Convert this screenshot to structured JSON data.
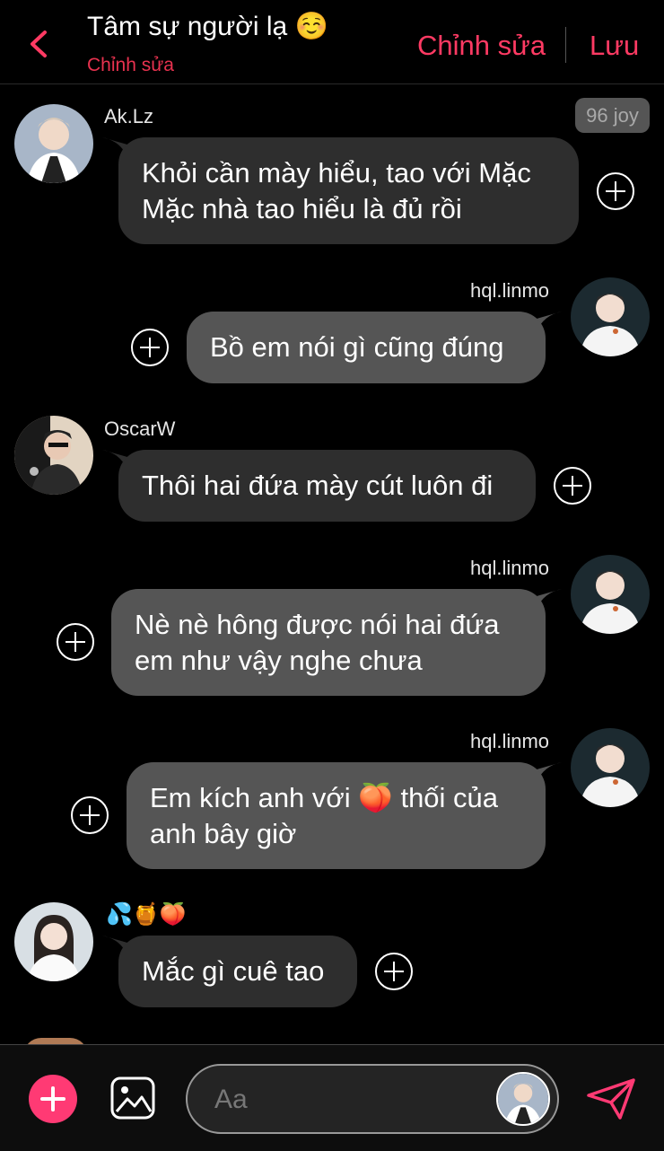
{
  "header": {
    "title": "Tâm sự người lạ ☺️",
    "subtitle": "Chỉnh sửa",
    "edit_label": "Chỉnh sửa",
    "save_label": "Lưu",
    "accent": "#ff3a63"
  },
  "badge": "96 joy",
  "messages": [
    {
      "sender": "Ak.Lz",
      "side": "left",
      "text_lines": [
        "Khỏi cần mày hiểu, tao với Mặc",
        "Mặc nhà tao hiểu là đủ rồi"
      ]
    },
    {
      "sender": "hql.linmo",
      "side": "right",
      "text_lines": [
        "Bồ em nói gì cũng đúng"
      ]
    },
    {
      "sender": "OscarW",
      "side": "left",
      "text_lines": [
        "Thôi hai đứa mày cút luôn đi"
      ]
    },
    {
      "sender": "hql.linmo",
      "side": "right",
      "text_lines": [
        "Nè nè hông được nói hai đứa",
        "em như vậy nghe chưa"
      ]
    },
    {
      "sender": "hql.linmo",
      "side": "right",
      "text_lines": [
        "Em kích anh với 🍑 thối của",
        "anh bây giờ"
      ]
    },
    {
      "sender": "💦🍯🍑",
      "side": "left",
      "text_lines": [
        "Mắc gì cuê tao"
      ]
    }
  ],
  "composer": {
    "placeholder": "Aa"
  },
  "icons": {
    "back": "chevron-left-icon",
    "add": "plus-icon",
    "image": "image-icon",
    "send": "send-icon",
    "message_action": "plus-circle-icon"
  }
}
